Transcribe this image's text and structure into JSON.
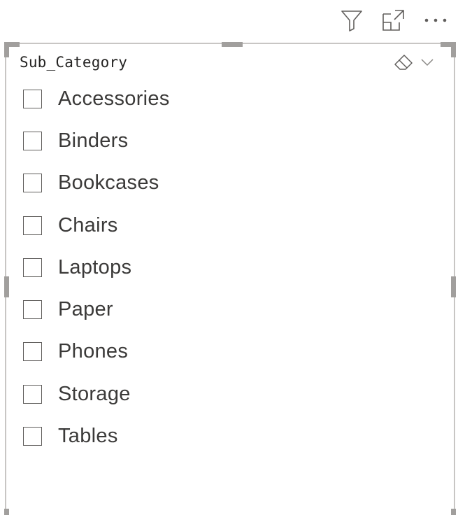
{
  "header": {
    "icons": [
      "filter-icon",
      "focus-mode-icon",
      "more-options-icon"
    ]
  },
  "slicer": {
    "title": "Sub_Category",
    "tools": [
      "eraser-icon",
      "chevron-down-icon"
    ],
    "items": [
      {
        "label": "Accessories",
        "checked": false
      },
      {
        "label": "Binders",
        "checked": false
      },
      {
        "label": "Bookcases",
        "checked": false
      },
      {
        "label": "Chairs",
        "checked": false
      },
      {
        "label": "Laptops",
        "checked": false
      },
      {
        "label": "Paper",
        "checked": false
      },
      {
        "label": "Phones",
        "checked": false
      },
      {
        "label": "Storage",
        "checked": false
      },
      {
        "label": "Tables",
        "checked": false
      }
    ]
  },
  "colors": {
    "border": "#c8c6c4",
    "handle": "#a19f9d",
    "text": "#3b3a39",
    "icon": "#605e5c"
  }
}
